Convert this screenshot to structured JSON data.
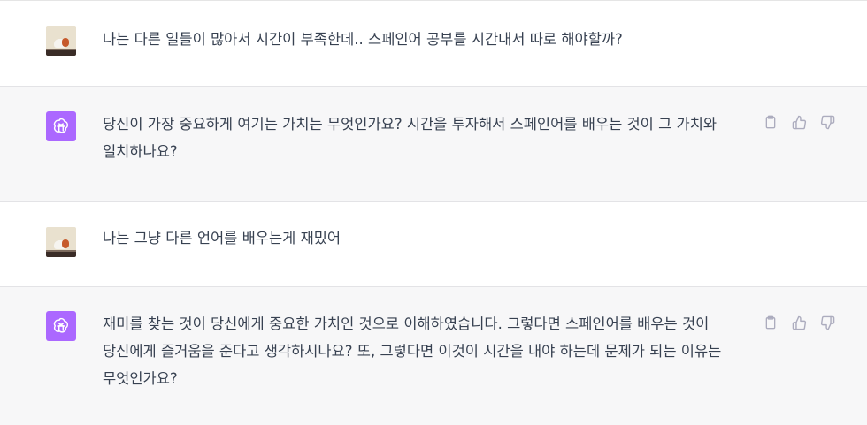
{
  "conversation": [
    {
      "role": "user",
      "avatar_icon": "user-avatar-bear",
      "text": "나는 다른 일들이 많아서 시간이 부족한데.. 스페인어 공부를 시간내서 따로 해야할까?"
    },
    {
      "role": "assistant",
      "avatar_icon": "openai-logo-icon",
      "text": "당신이 가장 중요하게 여기는 가치는 무엇인가요? 시간을 투자해서 스페인어를 배우는 것이 그 가치와 일치하나요?",
      "actions": [
        "copy-icon",
        "thumbs-up-icon",
        "thumbs-down-icon"
      ]
    },
    {
      "role": "user",
      "avatar_icon": "user-avatar-bear",
      "text": "나는 그냥 다른 언어를 배우는게 재밌어"
    },
    {
      "role": "assistant",
      "avatar_icon": "openai-logo-icon",
      "text": "재미를 찾는 것이 당신에게 중요한 가치인 것으로 이해하였습니다. 그렇다면 스페인어를 배우는 것이 당신에게 즐거움을 준다고 생각하시나요? 또, 그렇다면 이것이 시간을 내야 하는데 문제가 되는 이유는 무엇인가요?",
      "actions": [
        "copy-icon",
        "thumbs-up-icon",
        "thumbs-down-icon"
      ]
    }
  ],
  "colors": {
    "assistant_bg": "#f7f7f8",
    "user_bg": "#ffffff",
    "bot_avatar": "#ab68ff",
    "text": "#374151",
    "icon": "#acacbe"
  }
}
